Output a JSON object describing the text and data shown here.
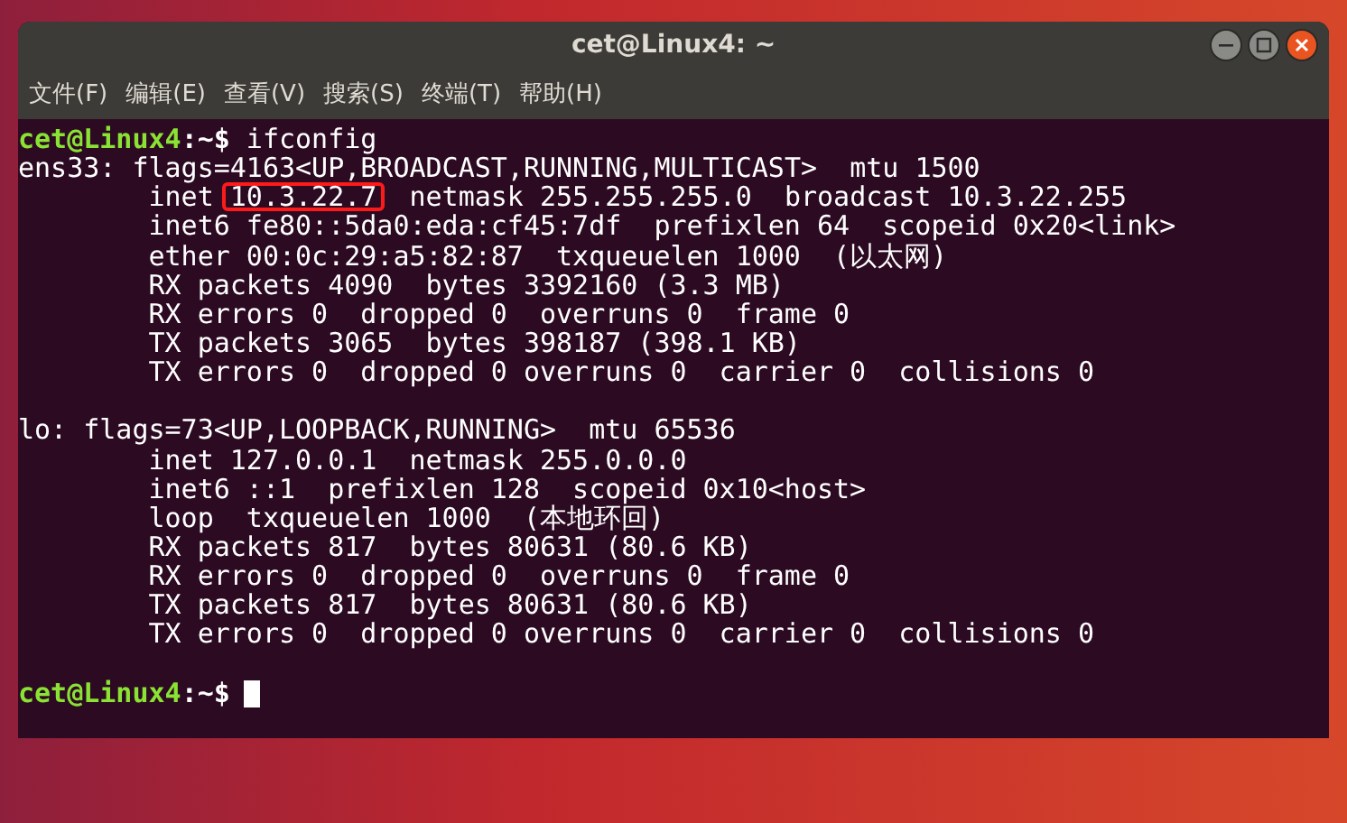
{
  "window": {
    "title": "cet@Linux4: ~"
  },
  "menu": [
    "文件(F)",
    "编辑(E)",
    "查看(V)",
    "搜索(S)",
    "终端(T)",
    "帮助(H)"
  ],
  "terminal": {
    "lines": [
      {
        "kind": "prompt",
        "user": "cet@Linux4",
        "path": ":~$",
        "command": "ifconfig",
        "cursor": false
      },
      {
        "kind": "output",
        "indented": false,
        "text": "ens33: flags=4163<UP,BROADCAST,RUNNING,MULTICAST>  mtu 1500"
      },
      {
        "kind": "annotated",
        "indented": true,
        "before": "inet ",
        "marked": "10.3.22.7",
        "after": "  netmask 255.255.255.0  broadcast 10.3.22.255"
      },
      {
        "kind": "output",
        "indented": true,
        "text": "inet6 fe80::5da0:eda:cf45:7df  prefixlen 64  scopeid 0x20<link>"
      },
      {
        "kind": "output",
        "indented": true,
        "text": "ether 00:0c:29:a5:82:87  txqueuelen 1000  (以太网)"
      },
      {
        "kind": "output",
        "indented": true,
        "text": "RX packets 4090  bytes 3392160 (3.3 MB)"
      },
      {
        "kind": "output",
        "indented": true,
        "text": "RX errors 0  dropped 0  overruns 0  frame 0"
      },
      {
        "kind": "output",
        "indented": true,
        "text": "TX packets 3065  bytes 398187 (398.1 KB)"
      },
      {
        "kind": "output",
        "indented": true,
        "text": "TX errors 0  dropped 0 overruns 0  carrier 0  collisions 0"
      },
      {
        "kind": "blank"
      },
      {
        "kind": "output",
        "indented": false,
        "text": "lo: flags=73<UP,LOOPBACK,RUNNING>  mtu 65536"
      },
      {
        "kind": "output",
        "indented": true,
        "text": "inet 127.0.0.1  netmask 255.0.0.0"
      },
      {
        "kind": "output",
        "indented": true,
        "text": "inet6 ::1  prefixlen 128  scopeid 0x10<host>"
      },
      {
        "kind": "output",
        "indented": true,
        "text": "loop  txqueuelen 1000  (本地环回)"
      },
      {
        "kind": "output",
        "indented": true,
        "text": "RX packets 817  bytes 80631 (80.6 KB)"
      },
      {
        "kind": "output",
        "indented": true,
        "text": "RX errors 0  dropped 0  overruns 0  frame 0"
      },
      {
        "kind": "output",
        "indented": true,
        "text": "TX packets 817  bytes 80631 (80.6 KB)"
      },
      {
        "kind": "output",
        "indented": true,
        "text": "TX errors 0  dropped 0 overruns 0  carrier 0  collisions 0"
      },
      {
        "kind": "blank"
      },
      {
        "kind": "prompt",
        "user": "cet@Linux4",
        "path": ":~$",
        "cursor": true
      }
    ]
  }
}
